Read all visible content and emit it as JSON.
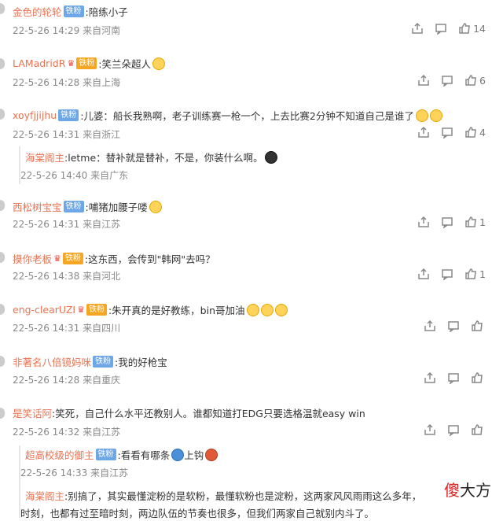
{
  "comments": [
    {
      "user": "金色的轮轮",
      "badge": "铁粉",
      "text": "陪练小子",
      "date": "22-5-26 14:29",
      "loc": "来自河南",
      "likes": "14"
    },
    {
      "user": "LAMadridR",
      "badge": "铁粉",
      "text": "笑兰朵超人",
      "date": "22-5-26 14:28",
      "loc": "来自上海",
      "likes": "6"
    },
    {
      "user": "xoyfjjijhu",
      "badge": "铁粉",
      "text": "儿婆：船长我熟啊，老子训练赛一枪一个，上去比赛2分钟不知道自己是谁了",
      "date": "22-5-26 14:31",
      "loc": "来自浙江",
      "likes": "4"
    },
    {
      "user": "西松树宝宝",
      "badge": "铁粉",
      "text": "哺猪加腰子喽",
      "date": "22-5-26 14:31",
      "loc": "来自江苏",
      "likes": "1"
    },
    {
      "user": "摸你老板",
      "badge": "铁粉",
      "text": "这东西，会传到\"韩网\"去吗？",
      "date": "22-5-26 14:38",
      "loc": "来自河北",
      "likes": "1"
    },
    {
      "user": "eng-clearUZI",
      "badge": "铁粉",
      "text": "朱开真的是好教练，bin哥加油",
      "date": "22-5-26 14:31",
      "loc": "来自四川",
      "likes": ""
    },
    {
      "user": "非著名八倍镜妈咪",
      "badge": "铁粉",
      "text": "我的好枪宝",
      "date": "22-5-26 14:28",
      "loc": "来自重庆",
      "likes": ""
    },
    {
      "user": "是笑话阿",
      "badge": "",
      "text": "笑死，自己什么水平还教别人。谁都知道打EDG只要选格温就easy win",
      "date": "22-5-26 14:32",
      "loc": "来自江苏",
      "likes": ""
    }
  ],
  "replies": [
    {
      "user": "海棠阁主",
      "text": ":letme：替补就是替补，不是，你装什么啊。",
      "date": "22-5-26 14:40",
      "loc": "来自广东"
    },
    {
      "user": "超高校级的御主",
      "badge": "铁粉",
      "text": "看看有哪条",
      "tail": "上钩",
      "date": "22-5-26 14:33",
      "loc": "来自江苏"
    },
    {
      "user": "海棠阁主",
      "text": "别搞了，其实最懂淀粉的是软粉，最懂软粉也是淀粉，这两家风风雨雨这么多年，",
      "text2": "时刻，也都有过至暗时刻，两边队伍的节奏也很多，但我们两家自己就别内斗了。"
    }
  ],
  "watermark": {
    "a": "傻",
    "b": "大方"
  },
  "icons": [
    "share-icon",
    "comment-icon",
    "like-icon"
  ]
}
